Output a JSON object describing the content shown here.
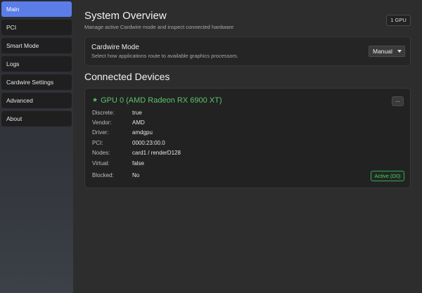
{
  "sidebar": {
    "items": [
      {
        "label": "Main",
        "active": true
      },
      {
        "label": "PCI",
        "active": false
      },
      {
        "label": "Smart Mode",
        "active": false
      },
      {
        "label": "Logs",
        "active": false
      },
      {
        "label": "Cardwire Settings",
        "active": false
      },
      {
        "label": "Advanced",
        "active": false
      },
      {
        "label": "About",
        "active": false
      }
    ]
  },
  "header": {
    "title": "System Overview",
    "subtitle": "Manage active Cardwire mode and inspect connected hardware",
    "gpu_count": "1 GPU"
  },
  "mode_card": {
    "title": "Cardwire Mode",
    "description": "Select how applications route to available graphics processors.",
    "selected": "Manual"
  },
  "devices": {
    "section_title": "Connected Devices",
    "list": [
      {
        "star": "★",
        "name": "GPU 0 (AMD Radeon RX 6900 XT)",
        "more_label": "...",
        "props": [
          {
            "label": "Discrete:",
            "value": "true"
          },
          {
            "label": "Vendor:",
            "value": "AMD"
          },
          {
            "label": "Driver:",
            "value": "amdgpu"
          },
          {
            "label": "PCI:",
            "value": "0000:23:00.0"
          },
          {
            "label": "Nodes:",
            "value": "card1 / renderD128"
          },
          {
            "label": "Virtual:",
            "value": "false"
          },
          {
            "label": "Blocked:",
            "value": "No"
          }
        ],
        "status": "Active (D0)"
      }
    ]
  },
  "colors": {
    "accent": "#5a7de8",
    "device_name": "#5cc36a",
    "status_border": "#3aa55a",
    "card_bg": "#222222",
    "page_bg": "#2d2d2d"
  },
  "icons": {
    "device_star": "star-icon",
    "mode_dropdown": "chevron-down-icon"
  }
}
